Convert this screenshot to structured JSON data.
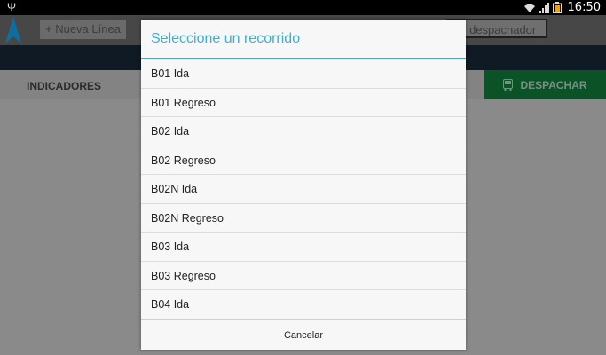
{
  "status_bar": {
    "time": "16:50",
    "usb_icon": "usb-icon",
    "wifi_icon": "wifi-icon",
    "signal_icon": "signal-icon",
    "battery_icon": "battery-icon"
  },
  "app_bar": {
    "new_line_label": "+ Nueva Línea",
    "dispatcher_value": "no despachador"
  },
  "tabs": {
    "indicators_label": "INDICADORES",
    "dispatch_label": "DESPACHAR",
    "dispatch_icon": "bus-icon"
  },
  "dialog": {
    "title": "Seleccione un recorrido",
    "items": [
      "B01 Ida",
      "B01 Regreso",
      "B02 Ida",
      "B02 Regreso",
      "B02N Ida",
      "B02N Regreso",
      "B03 Ida",
      "B03 Regreso",
      "B04 Ida"
    ],
    "cancel_label": "Cancelar"
  },
  "colors": {
    "accent": "#3bb0d3",
    "dispatch_bg": "#0c5227",
    "app_bar": "#474747"
  }
}
